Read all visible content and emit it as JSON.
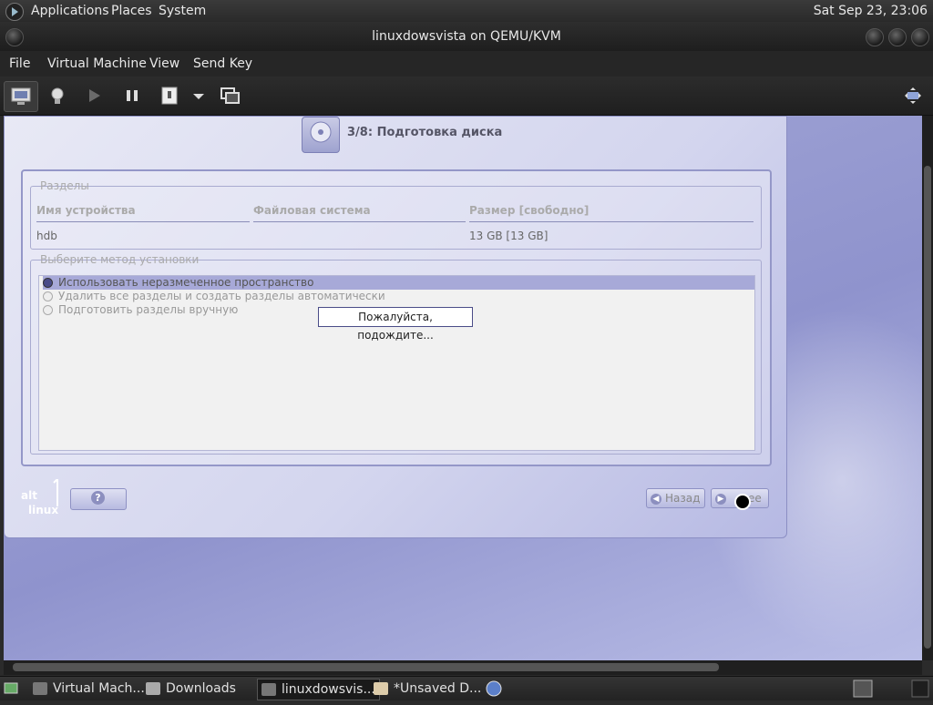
{
  "top_panel": {
    "menus": [
      "Applications",
      "Places",
      "System"
    ],
    "clock": "Sat Sep 23, 23:06"
  },
  "window": {
    "title": "linuxdowsvista on QEMU/KVM",
    "menubar": [
      "File",
      "Virtual Machine",
      "View",
      "Send Key"
    ]
  },
  "installer": {
    "step_title": "3/8: Подготовка диска",
    "partitions": {
      "legend": "Разделы",
      "columns": [
        "Имя устройства",
        "Файловая система",
        "Размер [свободно]"
      ],
      "rows": [
        [
          "hdb",
          "",
          "13 GB [13 GB]"
        ]
      ]
    },
    "method": {
      "legend": "Выберите метод установки",
      "options": [
        "Использовать неразмеченное пространство",
        "Удалить все разделы и создать разделы автоматически",
        "Подготовить разделы вручную"
      ],
      "selected_index": 0
    },
    "wait_popup": "Пожалуйста, подождите...",
    "logo_text": "alt linux",
    "back_label": "Назад",
    "next_label": "ее"
  },
  "taskbar": {
    "items": [
      "Virtual Mach...",
      "Downloads",
      "linuxdowsvis...",
      "*Unsaved D..."
    ],
    "active_index": 2
  }
}
